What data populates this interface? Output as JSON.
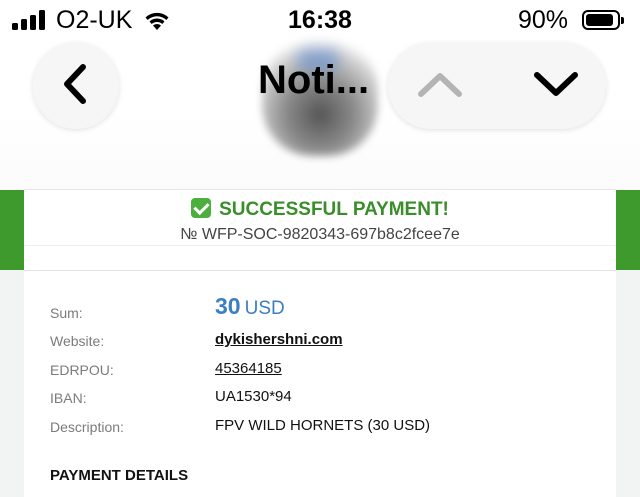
{
  "status_bar": {
    "carrier": "O2-UK",
    "time": "16:38",
    "battery_percent": "90%",
    "battery_level": 0.9,
    "icons": [
      "signal-icon",
      "wifi-icon",
      "battery-icon"
    ]
  },
  "nav": {
    "title": "Noti...",
    "back_icon": "chevron-left-icon",
    "up_icon": "chevron-up-icon",
    "down_icon": "chevron-down-icon"
  },
  "payment": {
    "status": "SUCCESSFUL PAYMENT!",
    "order_number": "№ WFP-SOC-9820343-697b8c2fcee7e"
  },
  "details": {
    "sum_label": "Sum:",
    "sum_amount": "30",
    "sum_currency": "USD",
    "website_label": "Website:",
    "website": "dykishershni.com",
    "edrpou_label": "EDRPOU:",
    "edrpou": "45364185",
    "iban_label": "IBAN:",
    "iban": "UA1530*94",
    "description_label": "Description:",
    "description": "FPV WILD HORNETS (30 USD)"
  },
  "section": {
    "payment_details": "PAYMENT DETAILS"
  },
  "colors": {
    "success_green": "#3a8e2a",
    "accent_blue": "#3a7fc1",
    "side_band": "#3f9a2e"
  }
}
